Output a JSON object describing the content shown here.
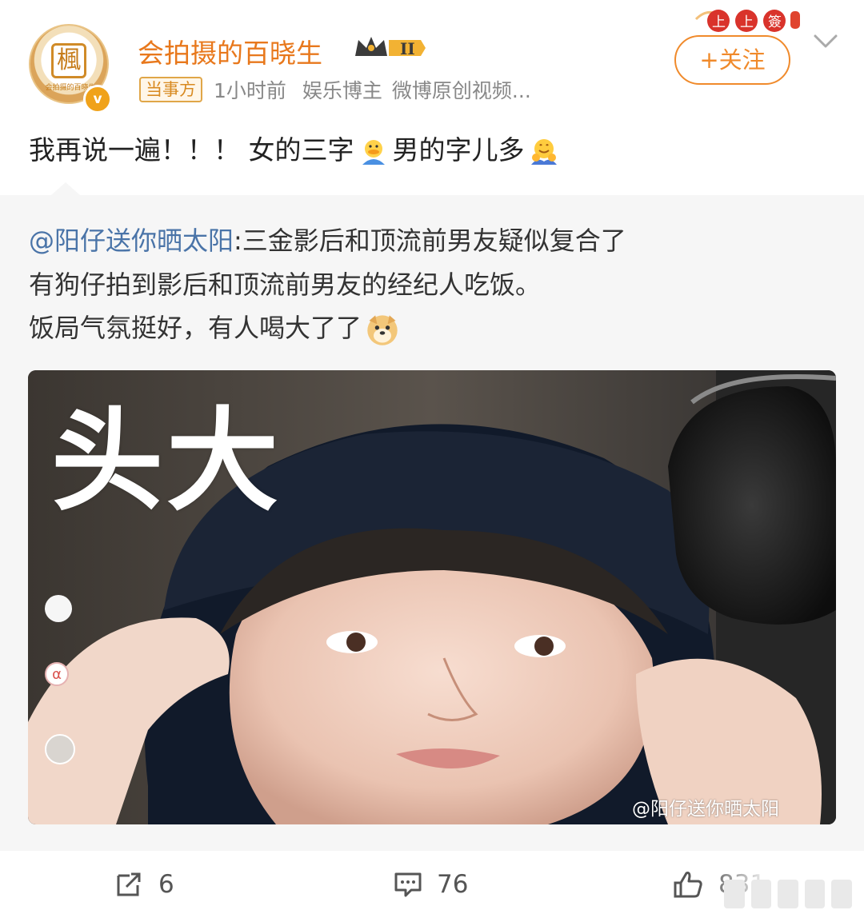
{
  "header": {
    "user_name": "会拍摄的百晓生",
    "crown_level": "II",
    "tag": "当事方",
    "time": "1小时前",
    "category": "娱乐博主",
    "source": "微博原创视频...",
    "follow_label": "+关注",
    "avatar_glyph": "楓",
    "avatar_caption": "会拍摄的百晓生",
    "verified_mark": "v",
    "lottery_chars": [
      "上",
      "上",
      "簽"
    ]
  },
  "post": {
    "text_part1": "我再说一遍！！！ 女的三字",
    "text_part2": "男的字儿多"
  },
  "repost": {
    "mention": "@阳仔送你晒太阳",
    "line1_rest": ":三金影后和顶流前男友疑似复合了",
    "line2": "有狗仔拍到影后和顶流前男友的经纪人吃饭。",
    "line3": "饭局气氛挺好，有人喝大了了",
    "image_overlay_text": "头大",
    "image_watermark": "@阳仔送你晒太阳",
    "side_icon_text": "α"
  },
  "actions": {
    "repost_count": "6",
    "comment_count": "76",
    "like_count": "831"
  },
  "colors": {
    "accent": "#f08a2b",
    "name": "#e8781c",
    "mention": "#4a74a8",
    "repost_bg": "#f6f6f6"
  },
  "icons": [
    "share-icon",
    "comment-icon",
    "thumbs-up-icon",
    "chevron-down-icon",
    "crown-icon",
    "verified-icon"
  ]
}
